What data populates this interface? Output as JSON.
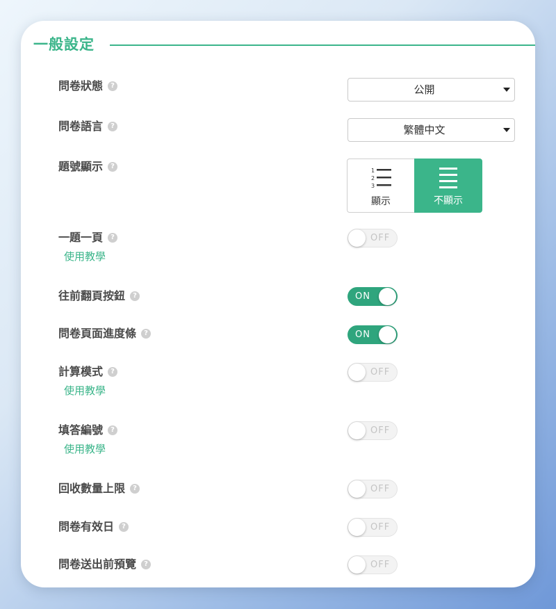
{
  "section": {
    "title": "一般設定"
  },
  "help_glyph": "?",
  "settings": {
    "status": {
      "label": "問卷狀態",
      "value": "公開"
    },
    "language": {
      "label": "問卷語言",
      "value": "繁體中文"
    },
    "numbering": {
      "label": "題號顯示",
      "options": [
        "顯示",
        "不顯示"
      ],
      "selected": "不顯示"
    },
    "one_per_page": {
      "label": "一題一頁",
      "tutorial": "使用教學",
      "state": "OFF"
    },
    "prev_button": {
      "label": "往前翻頁按鈕",
      "state": "ON"
    },
    "progress_bar": {
      "label": "問卷頁面進度條",
      "state": "ON"
    },
    "calc_mode": {
      "label": "計算模式",
      "tutorial": "使用教學",
      "state": "OFF"
    },
    "answer_number": {
      "label": "填答編號",
      "tutorial": "使用教學",
      "state": "OFF"
    },
    "response_limit": {
      "label": "回收數量上限",
      "state": "OFF"
    },
    "valid_date": {
      "label": "問卷有效日",
      "state": "OFF"
    },
    "preview": {
      "label": "問卷送出前預覽",
      "state": "OFF"
    }
  },
  "colors": {
    "accent": "#3bb58a",
    "toggle_on": "#2fa57d",
    "label_text": "#4a4a4a"
  },
  "icons": {
    "numbered_list": "numbered-list-icon",
    "plain_list": "list-icon",
    "help": "help-icon",
    "caret": "caret-down-icon"
  }
}
